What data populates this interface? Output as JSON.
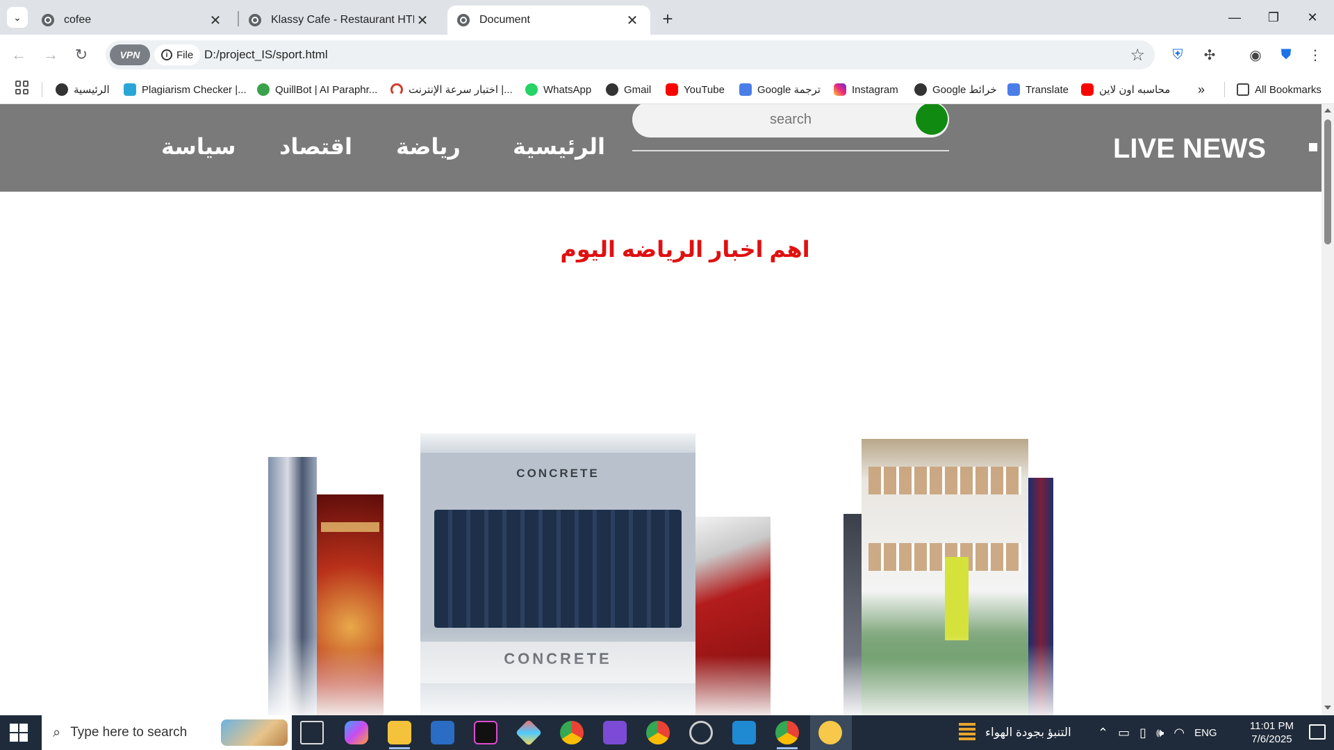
{
  "browser": {
    "tabs": [
      {
        "title": "cofee",
        "active": false
      },
      {
        "title": "Klassy Cafe - Restaurant HTML",
        "active": false
      },
      {
        "title": "Document",
        "active": true
      }
    ],
    "new_tab": "+",
    "vpn_label": "VPN",
    "file_label": "File",
    "url": "D:/project_IS/sport.html"
  },
  "bookmarks": [
    {
      "label": "الرئيسية",
      "color": "#333333"
    },
    {
      "label": "Plagiarism Checker |...",
      "color": "#2aa6d6"
    },
    {
      "label": "QuillBot | AI Paraphr...",
      "color": "#3aa24a"
    },
    {
      "label": "اختبار سرعة الإنترنت |...",
      "color": "#d23b2a"
    },
    {
      "label": "WhatsApp",
      "color": "#25d366"
    },
    {
      "label": "Gmail",
      "color": "#333333"
    },
    {
      "label": "YouTube",
      "color": "#ff0000"
    },
    {
      "label": "Google ترجمة",
      "color": "#4a7de8"
    },
    {
      "label": "Instagram",
      "color": "#d62976"
    },
    {
      "label": "Google خرائط",
      "color": "#333333"
    },
    {
      "label": "Translate",
      "color": "#4a7de8"
    },
    {
      "label": "محاسبه اون لاين",
      "color": "#ff0000"
    }
  ],
  "all_bookmarks": "All Bookmarks",
  "site": {
    "brand": "LIVE NEWS",
    "nav": [
      "الرئيسية",
      "رياضة",
      "اقتصاد",
      "سياسة"
    ],
    "search_placeholder": "search",
    "headline": "اهم اخبار الرياضه اليوم"
  },
  "taskbar": {
    "search_placeholder": "Type here to search",
    "weather_text": "التنبؤ بجودة الهواء",
    "language": "ENG",
    "time": "11:01 PM",
    "date": "7/6/2025"
  }
}
